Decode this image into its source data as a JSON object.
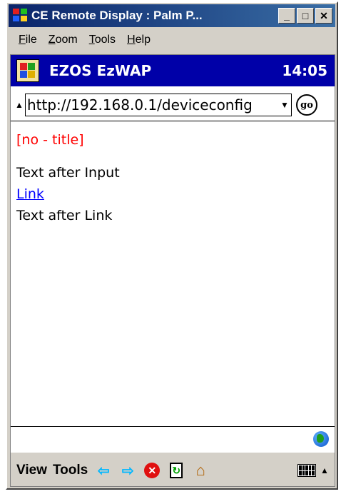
{
  "window": {
    "title": "CE Remote Display : Palm P...",
    "buttons": {
      "minimize": "_",
      "maximize": "□",
      "close": "✕"
    }
  },
  "menubar": {
    "items": [
      {
        "label": "File",
        "accel": "F",
        "rest": "ile"
      },
      {
        "label": "Zoom",
        "accel": "Z",
        "rest": "oom"
      },
      {
        "label": "Tools",
        "accel": "T",
        "rest": "ools"
      },
      {
        "label": "Help",
        "accel": "H",
        "rest": "elp"
      }
    ]
  },
  "device": {
    "app_name": "EZOS EzWAP",
    "clock": "14:05",
    "address": {
      "url": "http://192.168.0.1/deviceconfig",
      "go_label": "go"
    },
    "content": {
      "title": "[no - title]",
      "text_after_input": "Text after Input",
      "link_label": "Link",
      "text_after_link": "Text after Link"
    },
    "command_bar": {
      "view_label": "View",
      "tools_label": "Tools"
    }
  },
  "colors": {
    "title_red": "#ff0000",
    "link_blue": "#0000ff",
    "ce_bar": "#0000a8"
  }
}
